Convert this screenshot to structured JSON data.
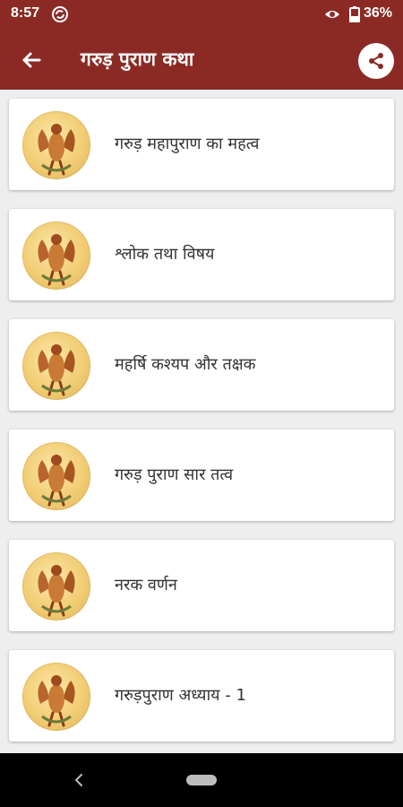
{
  "status_bar": {
    "time": "8:57",
    "battery_percent": "36%",
    "icons": [
      "sync-icon",
      "eye-icon",
      "battery-icon"
    ]
  },
  "app_bar": {
    "title": "गरुड़ पुराण कथा",
    "back_icon": "arrow-left-icon",
    "share_icon": "share-icon"
  },
  "colors": {
    "app_bar": "#8b2a24",
    "background": "#eeeeee",
    "card": "#ffffff",
    "nav_bar": "#000000"
  },
  "list": {
    "thumbnail_icon": "garuda-image",
    "items": [
      {
        "title": "गरुड़ महापुराण का महत्व"
      },
      {
        "title": "श्लोक तथा विषय"
      },
      {
        "title": "महर्षि कश्यप और तक्षक"
      },
      {
        "title": "गरुड़ पुराण सार तत्व"
      },
      {
        "title": "नरक वर्णन"
      },
      {
        "title": "गरुड़पुराण अध्याय - 1"
      }
    ]
  },
  "nav_bar": {
    "icons": [
      "nav-back-icon",
      "home-pill-icon"
    ]
  }
}
